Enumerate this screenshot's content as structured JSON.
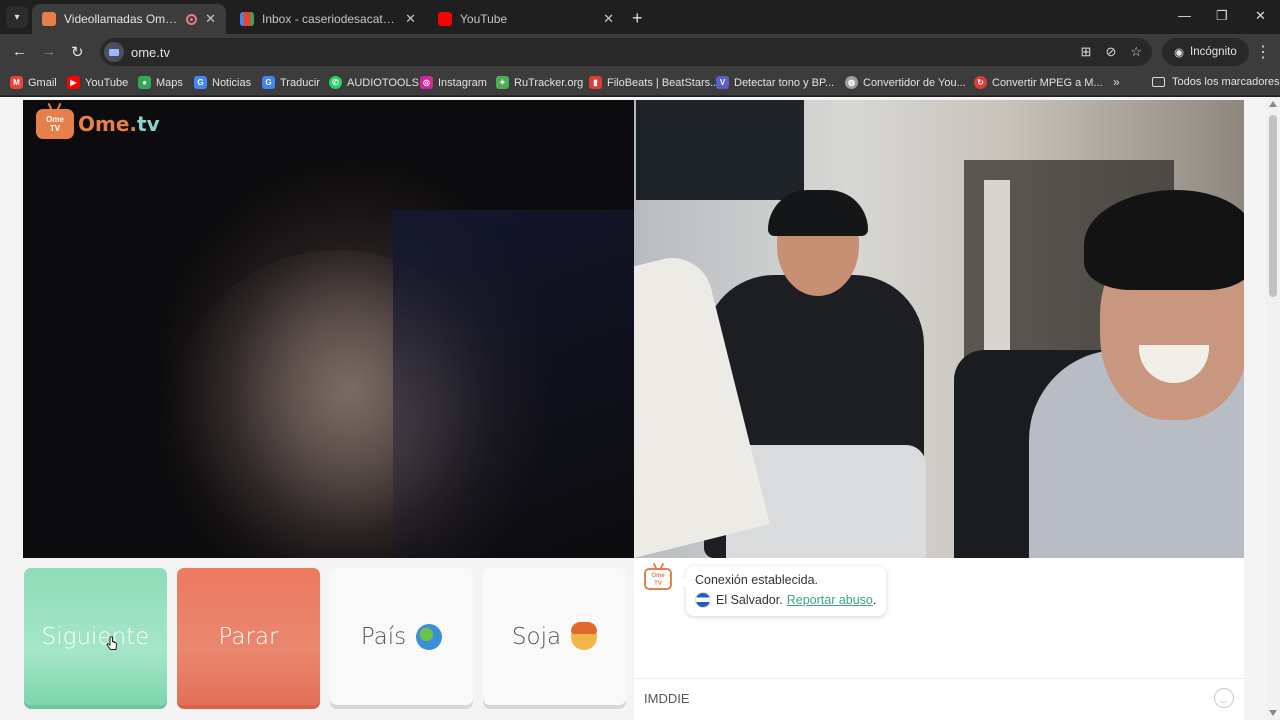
{
  "browser": {
    "tabs": [
      {
        "title": "Videollamadas OmeTV — A",
        "active": true,
        "favicon": "ometv-icon"
      },
      {
        "title": "Inbox - caseriodesacato@gmail",
        "active": false,
        "favicon": "gmail-icon"
      },
      {
        "title": "YouTube",
        "active": false,
        "favicon": "youtube-icon"
      }
    ],
    "url": "ome.tv",
    "incognito_label": "Incógnito"
  },
  "bookmarks": [
    {
      "label": "Gmail",
      "icon": "gmail-icon",
      "color": "#ea4335"
    },
    {
      "label": "YouTube",
      "icon": "youtube-icon",
      "color": "#ff0000"
    },
    {
      "label": "Maps",
      "icon": "maps-icon",
      "color": "#34a853"
    },
    {
      "label": "Noticias",
      "icon": "news-icon",
      "color": "#4285f4"
    },
    {
      "label": "Traducir",
      "icon": "translate-icon",
      "color": "#4285f4"
    },
    {
      "label": "AUDIOTOOLS",
      "icon": "whatsapp-icon",
      "color": "#25d366"
    },
    {
      "label": "Instagram",
      "icon": "instagram-icon",
      "color": "#d6249f"
    },
    {
      "label": "RuTracker.org",
      "icon": "rutracker-icon",
      "color": "#4caf50"
    },
    {
      "label": "FiloBeats | BeatStars...",
      "icon": "filobeats-icon",
      "color": "#e53935"
    },
    {
      "label": "Detectar tono y BP...",
      "icon": "v-icon",
      "color": "#5b5fc7"
    },
    {
      "label": "Convertidor de You...",
      "icon": "globe-icon",
      "color": "#9e9e9e"
    },
    {
      "label": "Convertir MPEG a M...",
      "icon": "convert-icon",
      "color": "#e53935"
    }
  ],
  "bookmarks_folder": "Todos los marcadores",
  "site": {
    "logo": {
      "badge_top": "Ome",
      "badge_bottom": "TV",
      "name_a": "Ome",
      "name_dot": ".",
      "name_b": "tv"
    },
    "buttons": {
      "next": "Siguiente",
      "stop": "Parar",
      "country": "País",
      "gender": "Soja"
    },
    "chat": {
      "logo_top": "Ome",
      "logo_bottom": "TV",
      "status": "Conexión establecida.",
      "country": "El Salvador.",
      "report": "Reportar abuso",
      "report_suffix": ".",
      "input_value": "IMDDIE"
    }
  },
  "colors": {
    "next": "#8fdcb8",
    "stop": "#ec7a5f",
    "brand": "#e77f4a",
    "link": "#3da58a"
  }
}
